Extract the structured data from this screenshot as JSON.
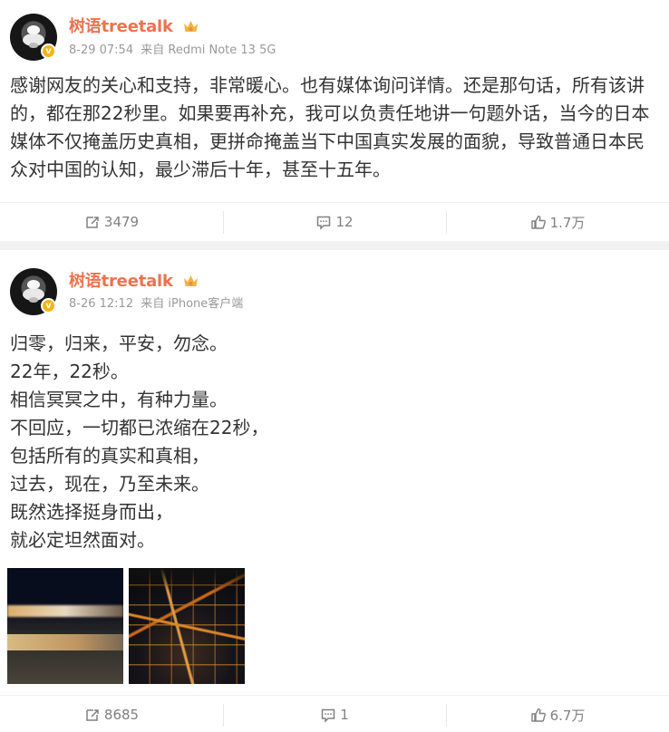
{
  "colors": {
    "username": "#eb7350",
    "meta": "#999999",
    "action": "#808080",
    "divider": "#f2f2f2",
    "verified_badge": "#f6b417"
  },
  "posts": [
    {
      "author": "树语treetalk",
      "verified_icon": "verified-badge-icon",
      "vip_icon": "crown-icon",
      "date": "8-29 07:54",
      "source": "来自 Redmi Note 13 5G",
      "text": "感谢网友的关心和支持，非常暖心。也有媒体询问详情。还是那句话，所有该讲的，都在那22秒里。如果要再补充，我可以负责任地讲一句题外话，当今的日本媒体不仅掩盖历史真相，更拼命掩盖当下中国真实发展的面貌，导致普通日本民众对中国的认知，最少滞后十年，甚至十五年。",
      "actions": {
        "repost_icon": "repost-icon",
        "repost": "3479",
        "comment_icon": "comment-icon",
        "comment": "12",
        "like_icon": "like-icon",
        "like": "1.7万"
      }
    },
    {
      "author": "树语treetalk",
      "verified_icon": "verified-badge-icon",
      "vip_icon": "crown-icon",
      "date": "8-26 12:12",
      "source": "来自 iPhone客户端",
      "lines": [
        "归零，归来，平安，勿念。",
        "22年，22秒。",
        "相信冥冥之中，有种力量。",
        "不回应，一切都已浓缩在22秒，",
        "包括所有的真实和真相，",
        "过去，现在，乃至未来。",
        "既然选择挺身而出，",
        "就必定坦然面对。"
      ],
      "images": [
        "airport-night-photo",
        "city-lights-aerial-photo"
      ],
      "actions": {
        "repost_icon": "repost-icon",
        "repost": "8685",
        "comment_icon": "comment-icon",
        "comment": "1",
        "like_icon": "like-icon",
        "like": "6.7万"
      }
    }
  ]
}
